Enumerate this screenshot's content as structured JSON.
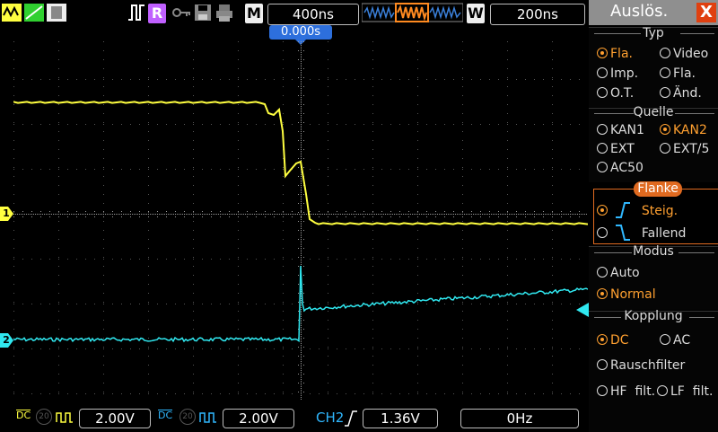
{
  "topbar": {
    "mode_letter_r": "R",
    "timebase_letter": "M",
    "timebase_value": "400ns",
    "window_letter": "W",
    "window_value": "200ns"
  },
  "screen": {
    "trigger_time": "0.000s",
    "ch1_marker": "1",
    "ch2_marker": "2",
    "colors": {
      "ch1": "#ffff40",
      "ch2": "#30e8f0",
      "grid": "#666666"
    }
  },
  "panel": {
    "title": "Auslös.",
    "close_label": "X",
    "typ": {
      "title": "Typ",
      "options": [
        {
          "label": "Fla.",
          "selected": true
        },
        {
          "label": "Video",
          "selected": false
        },
        {
          "label": "Imp.",
          "selected": false
        },
        {
          "label": "Fla.",
          "selected": false
        },
        {
          "label": "O.T.",
          "selected": false
        },
        {
          "label": "Änd.",
          "selected": false
        }
      ]
    },
    "quelle": {
      "title": "Quelle",
      "options": [
        {
          "label": "KAN1",
          "selected": false
        },
        {
          "label": "KAN2",
          "selected": true
        },
        {
          "label": "EXT",
          "selected": false
        },
        {
          "label": "EXT/5",
          "selected": false
        },
        {
          "label": "AC50",
          "selected": false
        }
      ]
    },
    "flanke": {
      "title": "Flanke",
      "options": [
        {
          "label": "Steig.",
          "selected": true
        },
        {
          "label": "Fallend",
          "selected": false
        }
      ]
    },
    "modus": {
      "title": "Modus",
      "options": [
        {
          "label": "Auto",
          "selected": false
        },
        {
          "label": "Normal",
          "selected": true
        }
      ]
    },
    "kopplung": {
      "title": "Kopplung",
      "options": [
        {
          "label": "DC",
          "selected": true
        },
        {
          "label": "AC",
          "selected": false
        },
        {
          "label": "Rauschfilter",
          "selected": false
        },
        {
          "label": "HF  filt.",
          "selected": false
        },
        {
          "label": "LF  filt.",
          "selected": false
        }
      ]
    }
  },
  "bottombar": {
    "ch1_coupling": "DC",
    "ch1_bw": "20",
    "ch1_volts": "2.00V",
    "ch2_coupling": "DC",
    "ch2_bw": "20",
    "ch2_volts": "2.00V",
    "trigger_source": "CH2",
    "trigger_level": "1.36V",
    "frequency": "0Hz"
  }
}
